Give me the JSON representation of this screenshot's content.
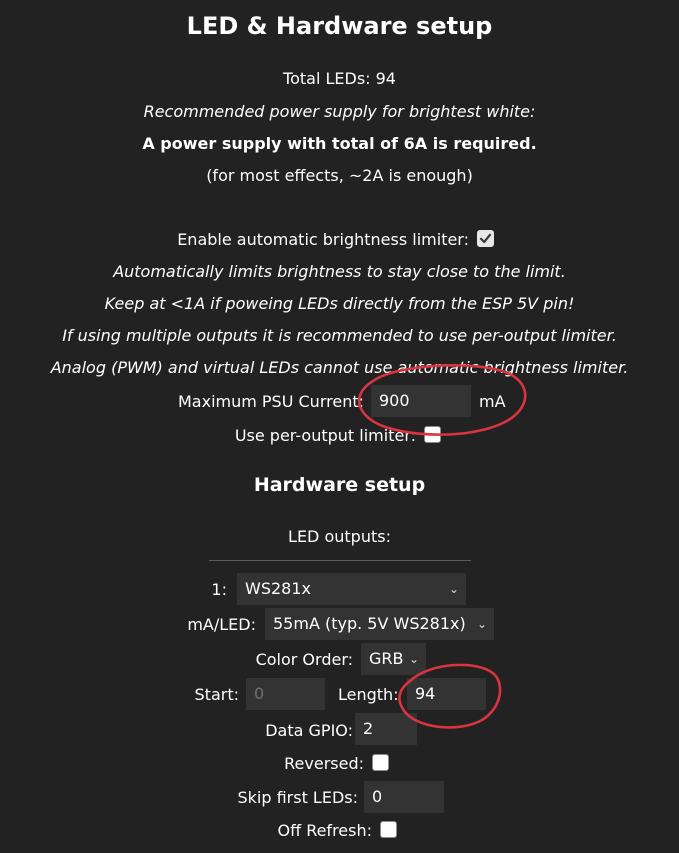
{
  "page": {
    "title": "LED & Hardware setup",
    "total_leds_label": "Total LEDs: 94",
    "psu_recommend": "Recommended power supply for brightest white:",
    "psu_required": "A power supply with total of 6A is required.",
    "psu_effects": "(for most effects, ~2A is enough)"
  },
  "limiter": {
    "enable_label": "Enable automatic brightness limiter:",
    "enable_checked": true,
    "note1": "Automatically limits brightness to stay close to the limit.",
    "note2": "Keep at <1A if poweing LEDs directly from the ESP 5V pin!",
    "note3": "If using multiple outputs it is recommended to use per-output limiter.",
    "note4": "Analog (PWM) and virtual LEDs cannot use automatic brightness limiter.",
    "max_current_label": "Maximum PSU Current:",
    "max_current_value": "900",
    "max_current_unit": "mA",
    "per_output_label": "Use per-output limiter:",
    "per_output_checked": false
  },
  "hardware": {
    "title": "Hardware setup",
    "outputs_label": "LED outputs:",
    "output_index": "1:",
    "led_type": "WS281x",
    "ma_led_label": "mA/LED:",
    "ma_led_value": "55mA (typ. 5V WS281x)",
    "color_order_label": "Color Order:",
    "color_order_value": "GRB",
    "start_label": "Start:",
    "start_value": "0",
    "length_label": "Length:",
    "length_value": "94",
    "gpio_label": "Data GPIO:",
    "gpio_value": "2",
    "reversed_label": "Reversed:",
    "reversed_checked": false,
    "skip_label": "Skip first LEDs:",
    "skip_value": "0",
    "off_refresh_label": "Off Refresh:",
    "off_refresh_checked": false
  },
  "icons": {
    "dropdown": "chevron-down-icon",
    "check": "checkmark-icon"
  },
  "colors": {
    "background": "#222222",
    "input_background": "#333333",
    "annotation_red": "#d9343f"
  }
}
